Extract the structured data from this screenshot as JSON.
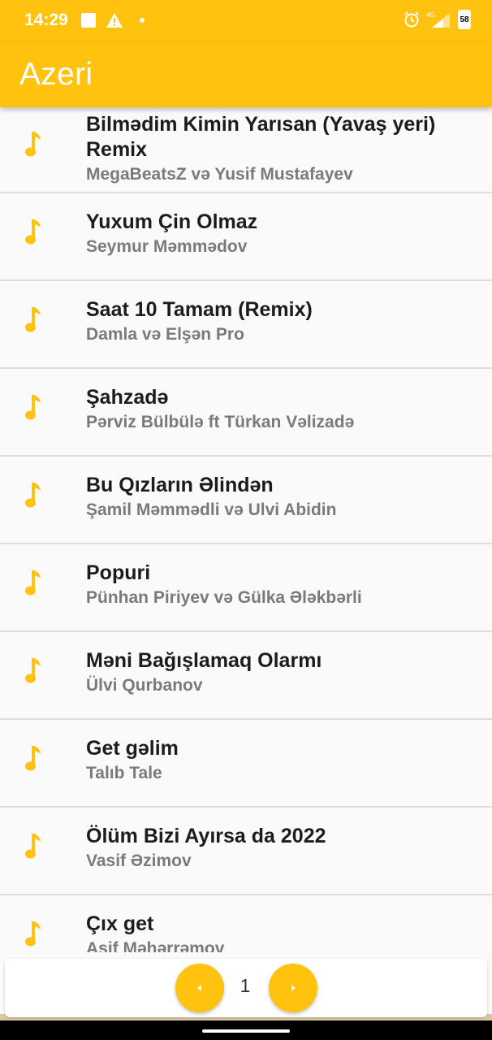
{
  "status_bar": {
    "time": "14:29",
    "network": "4G",
    "battery": "58"
  },
  "app_bar": {
    "title": "Azeri"
  },
  "songs": [
    {
      "title": "Bilmədim Kimin Yarısan (Yavaş yeri) Remix",
      "artist": "MegaBeatsZ və Yusif Mustafayev"
    },
    {
      "title": "Yuxum Çin Olmaz",
      "artist": "Seymur Məmmədov"
    },
    {
      "title": "Saat 10 Tamam (Remix)",
      "artist": "Damla və Elşən Pro"
    },
    {
      "title": "Şahzadə",
      "artist": "Pərviz Bülbülə ft Türkan Vəlizadə"
    },
    {
      "title": "Bu Qızların Əlindən",
      "artist": "Şamil Məmmədli və Ulvi Abidin"
    },
    {
      "title": "Popuri",
      "artist": "Pünhan Piriyev və Gülka Ələkbərli"
    },
    {
      "title": "Məni Bağışlamaq Olarmı",
      "artist": "Ülvi Qurbanov"
    },
    {
      "title": "Get gəlim",
      "artist": "Talıb Tale"
    },
    {
      "title": "Ölüm Bizi Ayırsa da 2022",
      "artist": "Vasif Əzimov"
    },
    {
      "title": "Çıx get",
      "artist": "Asif Məhərrəmov"
    }
  ],
  "pagination": {
    "current_page": "1"
  },
  "colors": {
    "accent": "#ffc20e",
    "title_text": "#1c1c1c",
    "artist_text": "#7a7a7a"
  },
  "icons": {
    "song": "music-note-icon",
    "prev": "chevron-left-icon",
    "next": "chevron-right-icon"
  }
}
